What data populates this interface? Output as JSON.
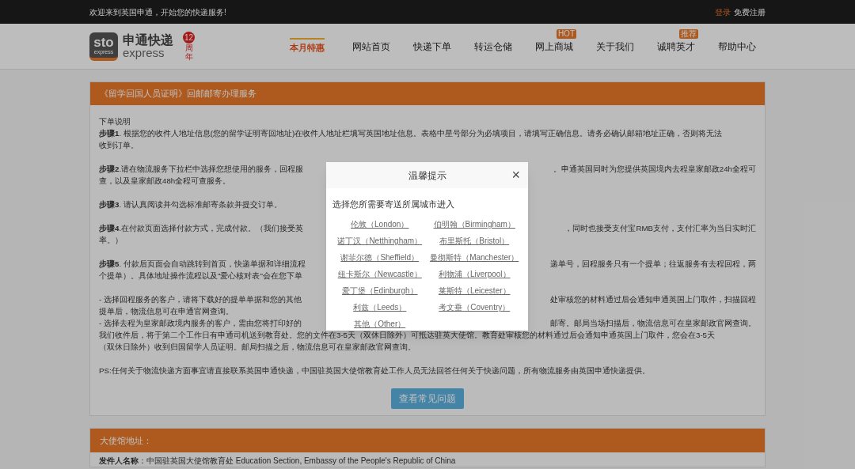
{
  "top_bar": {
    "welcome": "欢迎来到英国申通，开始您的快递服务!",
    "login": "登录",
    "register": "免费注册"
  },
  "header": {
    "logo": {
      "mark": "sto",
      "mark_sub": "express",
      "name_cn": "申通快递",
      "name_en": "express",
      "anniversary_number": "12",
      "anniversary_chars": [
        "周",
        "年"
      ]
    },
    "promo": "本月特惠",
    "nav": [
      {
        "label": "网站首页"
      },
      {
        "label": "快递下单"
      },
      {
        "label": "转运仓储"
      },
      {
        "label": "网上商城",
        "badge": "HOT"
      },
      {
        "label": "关于我们"
      },
      {
        "label": "诚聘英才",
        "badge": "推荐"
      },
      {
        "label": "帮助中心"
      }
    ]
  },
  "card": {
    "title": "《留学回国人员证明》回邮邮寄办理服务",
    "paragraphs": [
      [
        {
          "left": "下单说明"
        },
        {
          "left": "**步骤1**. 根据您的收件人地址信息(您的留学证明寄回地址)在收件人地址栏填写英国地址信息。表格中星号部分为必填项目，请填写正确信息。请务必确认邮箱地址正确，否则将无法"
        },
        {
          "left": "收到订单。"
        }
      ],
      [
        {
          "left": "**步骤2**.请在物流服务下拉栏中选择您想使用的服务，回程服",
          "right": "。申通英国同时为您提供英国境内去程皇家邮政24h全程可"
        },
        {
          "left": "查，以及皇家邮政48h全程可查服务。"
        }
      ],
      [
        {
          "left": "**步骤3**. 请认真阅读并勾选标准邮寄条款并提交订单。"
        }
      ],
      [
        {
          "left": "**步骤4**.在付款页面选择付款方式，完成付款。（我们接受英",
          "right": "，同时也接受支付宝RMB支付，支付汇率为当日实时汇"
        },
        {
          "left": "率。）"
        }
      ],
      [
        {
          "left": "**步骤5**. 付款后页面会自动跳转到首页，快递单据和详细流程",
          "right": "递单号，回程服务只有一个提单；往返服务有去程回程，两"
        },
        {
          "left": "个提单）。具体地址操作流程以及\"爱心核对表\"会在您下单"
        }
      ],
      [
        {
          "left": "- 选择回程服务的客户，请将下载好的提单单据和您的其他",
          "right": "处审核您的材料通过后会通知申通英国上门取件，扫描回程"
        },
        {
          "left": "提单后，物流信息可在申通官网查询。"
        },
        {
          "left": "- 选择去程为皇家邮政境内服务的客户，需由您将打印好的",
          "right": "邮寄。邮局当场扫描后，物流信息可在皇家邮政官网查询。"
        },
        {
          "left": "我们收件后，将于第二个工作日有申通司机送到教育处。您的文件在3-5天（双休日除外）可抵达驻英大使馆。教育处审核您的材料通过后会通知申通英国上门取件，您会在3-5天"
        },
        {
          "left": "（双休日除外）收到归国留学人员证明。邮局扫描之后，物流信息可在皇家邮政官网查询。"
        }
      ],
      [
        {
          "left": "PS:任何关于物流快递方面事宜请直接联系英国申通快递，中国驻英国大使馆教育处工作人员无法回答任何关于快递问题，所有物流服务由英国申通快递提供。"
        }
      ]
    ],
    "button": "查看常见问题"
  },
  "embassy": {
    "title": "大使馆地址：",
    "line": "**发件人名称**：中国驻英国大使馆教育处 Education Section, Embassy of the People's Republic of China"
  },
  "dialog": {
    "title": "温馨提示",
    "close": "×",
    "prompt": "选择您所需要寄送所属城市进入",
    "cities": [
      "伦敦（London）",
      "伯明翰（Birmingham）",
      "诺丁汉（Netthingham）",
      "布里斯托（Bristol）",
      "谢菲尔德（Sheffield）",
      "曼彻斯特（Manchester）",
      "纽卡斯尔（Newcastle）",
      "利物浦（Liverpool）",
      "爱丁堡（Edinburgh）",
      "莱斯特（Leicester）",
      "利兹（Leeds）",
      "考文垂（Coventry）",
      "其他（Other）"
    ]
  }
}
